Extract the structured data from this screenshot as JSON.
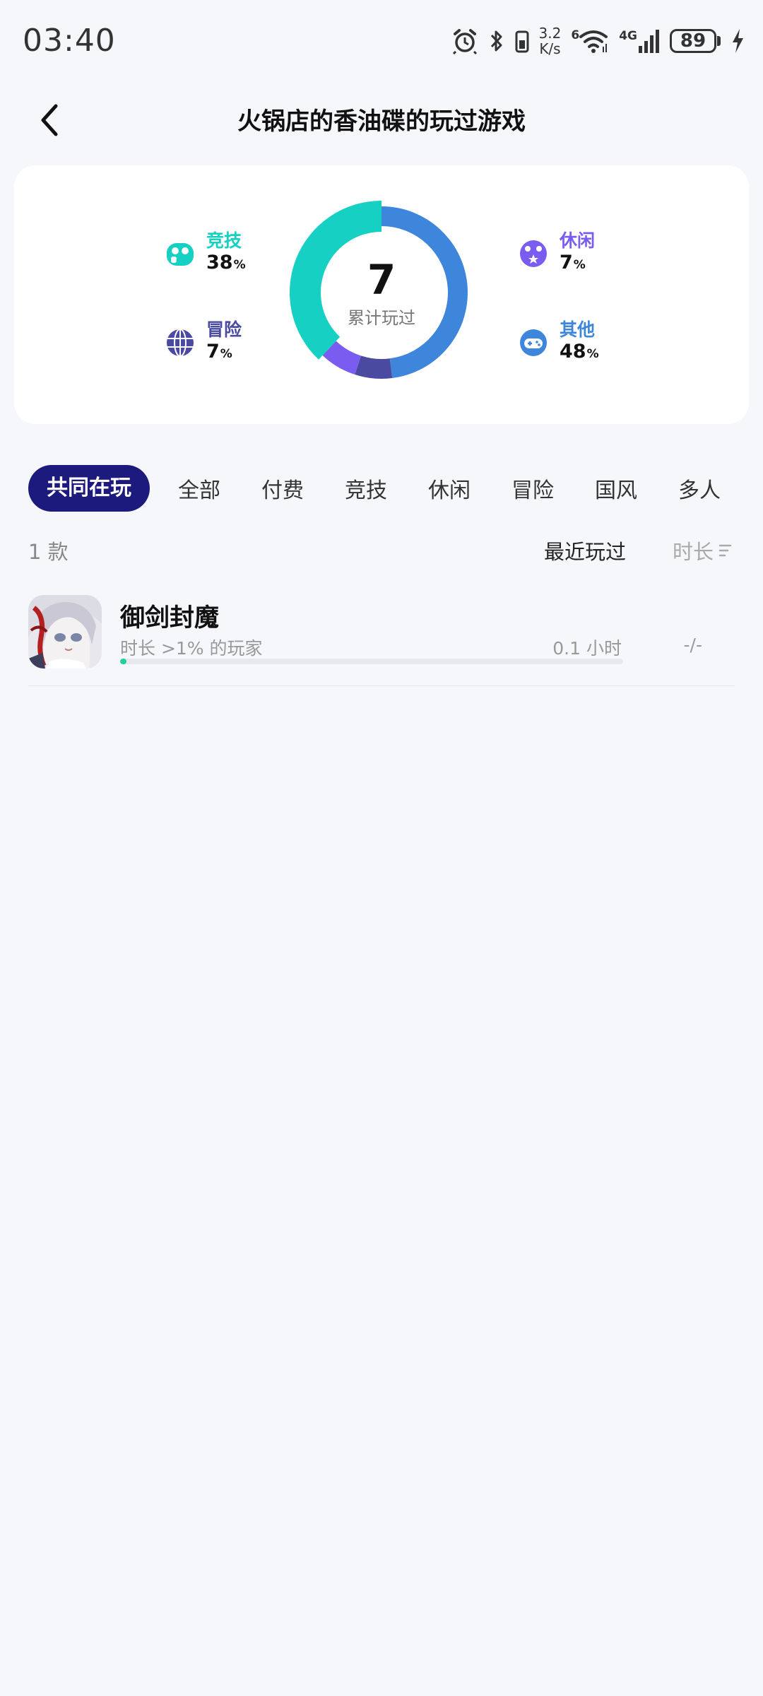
{
  "status": {
    "time": "03:40",
    "net_speed_value": "3.2",
    "net_speed_unit": "K/s",
    "wifi_badge": "6",
    "cell_label": "4G",
    "battery": "89"
  },
  "header": {
    "title": "火锅店的香油碟的玩过游戏"
  },
  "summary": {
    "total": "7",
    "total_label": "累计玩过",
    "categories": [
      {
        "name": "竞技",
        "pct": "38",
        "color": "#16d0c3",
        "icon": "competitive-icon"
      },
      {
        "name": "冒险",
        "pct": "7",
        "color": "#4a4aa0",
        "icon": "globe-icon"
      },
      {
        "name": "休闲",
        "pct": "7",
        "color": "#7b5cf0",
        "icon": "dice-icon"
      },
      {
        "name": "其他",
        "pct": "48",
        "color": "#3d86dc",
        "icon": "gamepad-icon"
      }
    ],
    "pct_unit": "%"
  },
  "tabs": [
    "共同在玩",
    "全部",
    "付费",
    "竞技",
    "休闲",
    "冒险",
    "国风",
    "多人"
  ],
  "list": {
    "count": "1 款",
    "sort_recent": "最近玩过",
    "sort_duration": "时长",
    "games": [
      {
        "name": "御剑封魔",
        "subtitle": "时长 >1% 的玩家",
        "hours": "0.1 小时",
        "rank": "-/-",
        "progress": 0.01
      }
    ]
  }
}
